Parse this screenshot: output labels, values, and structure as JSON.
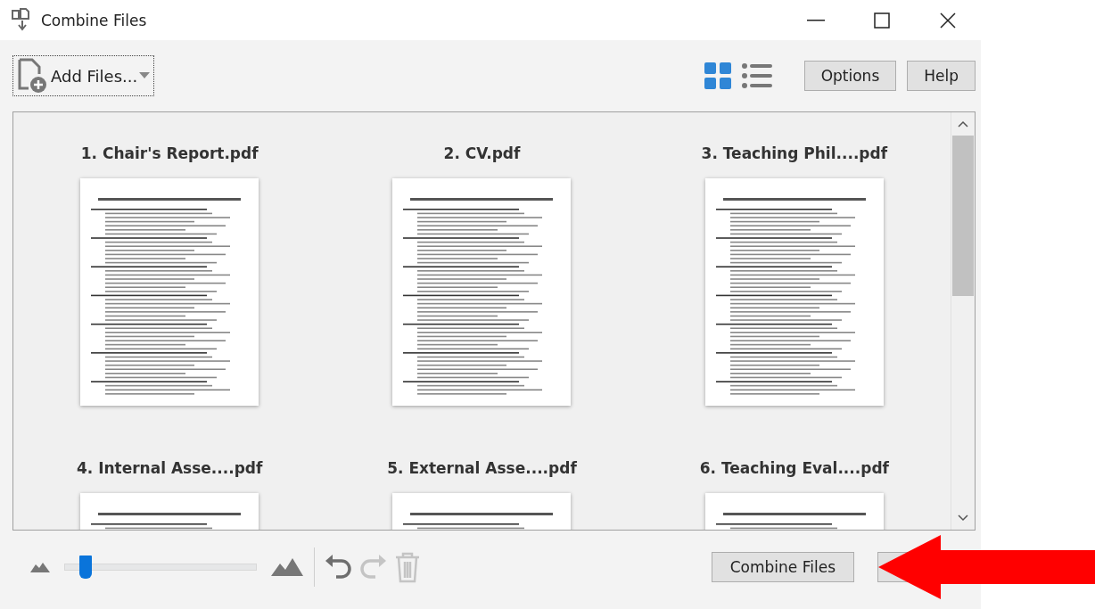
{
  "window": {
    "title": "Combine Files"
  },
  "toolbar": {
    "add_files": "Add Files...",
    "view_modes": [
      {
        "kind": "grid",
        "selected": true
      },
      {
        "kind": "list",
        "selected": false
      }
    ],
    "buttons": [
      "Options",
      "Help"
    ]
  },
  "files": [
    {
      "name": "1. Chair's Report.pdf"
    },
    {
      "name": "2. CV.pdf"
    },
    {
      "name": "3. Teaching Phil....pdf"
    },
    {
      "name": "4. Internal Asse....pdf"
    },
    {
      "name": "5. External Asse....pdf"
    },
    {
      "name": "6. Teaching Eval....pdf"
    }
  ],
  "zoom": {
    "level": 0.11
  },
  "actions": [
    {
      "kind": "undo",
      "disabled": false
    },
    {
      "kind": "redo",
      "disabled": true
    },
    {
      "kind": "delete",
      "disabled": true
    }
  ],
  "footer_buttons": [
    "Combine Files"
  ]
}
